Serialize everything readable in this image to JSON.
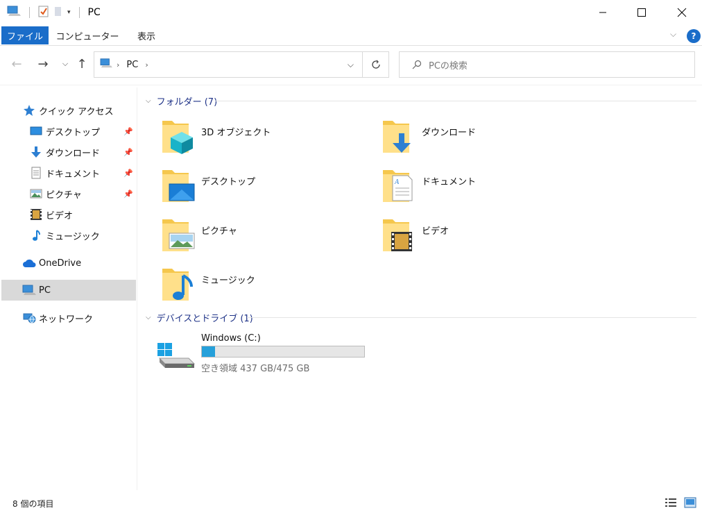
{
  "window": {
    "title": "PC",
    "colors": {
      "accent": "#1a6dc9",
      "group_header": "#1e3287",
      "drive_fill": "#26a0da"
    }
  },
  "quick_access_toolbar": {
    "icons": [
      "pc-icon",
      "properties-icon",
      "new-folder-icon",
      "customize-dropdown-icon"
    ]
  },
  "ribbon": {
    "tabs": [
      {
        "label": "ファイル",
        "active": true
      },
      {
        "label": "コンピューター",
        "active": false
      },
      {
        "label": "表示",
        "active": false
      }
    ]
  },
  "address_bar": {
    "location": "PC",
    "search_placeholder": "PCの検索"
  },
  "sidebar": {
    "quick_access": "クイック アクセス",
    "items": [
      {
        "label": "デスクトップ",
        "pinned": true,
        "icon": "desktop-icon"
      },
      {
        "label": "ダウンロード",
        "pinned": true,
        "icon": "download-icon"
      },
      {
        "label": "ドキュメント",
        "pinned": true,
        "icon": "document-icon"
      },
      {
        "label": "ピクチャ",
        "pinned": true,
        "icon": "pictures-icon"
      },
      {
        "label": "ビデオ",
        "pinned": false,
        "icon": "video-icon"
      },
      {
        "label": "ミュージック",
        "pinned": false,
        "icon": "music-icon"
      }
    ],
    "onedrive": "OneDrive",
    "pc": "PC",
    "network": "ネットワーク"
  },
  "folders_group": {
    "header": "フォルダー (7)",
    "folders": [
      {
        "label": "3D オブジェクト",
        "icon": "3d-objects-folder-icon"
      },
      {
        "label": "ダウンロード",
        "icon": "downloads-folder-icon"
      },
      {
        "label": "デスクトップ",
        "icon": "desktop-folder-icon"
      },
      {
        "label": "ドキュメント",
        "icon": "documents-folder-icon"
      },
      {
        "label": "ピクチャ",
        "icon": "pictures-folder-icon"
      },
      {
        "label": "ビデオ",
        "icon": "videos-folder-icon"
      },
      {
        "label": "ミュージック",
        "icon": "music-folder-icon"
      }
    ]
  },
  "devices_group": {
    "header": "デバイスとドライブ (1)",
    "drive": {
      "label": "Windows (C:)",
      "free_text": "空き領域 437 GB/475 GB",
      "used_fraction": 0.08
    }
  },
  "status_bar": {
    "item_count": "8 個の項目"
  }
}
